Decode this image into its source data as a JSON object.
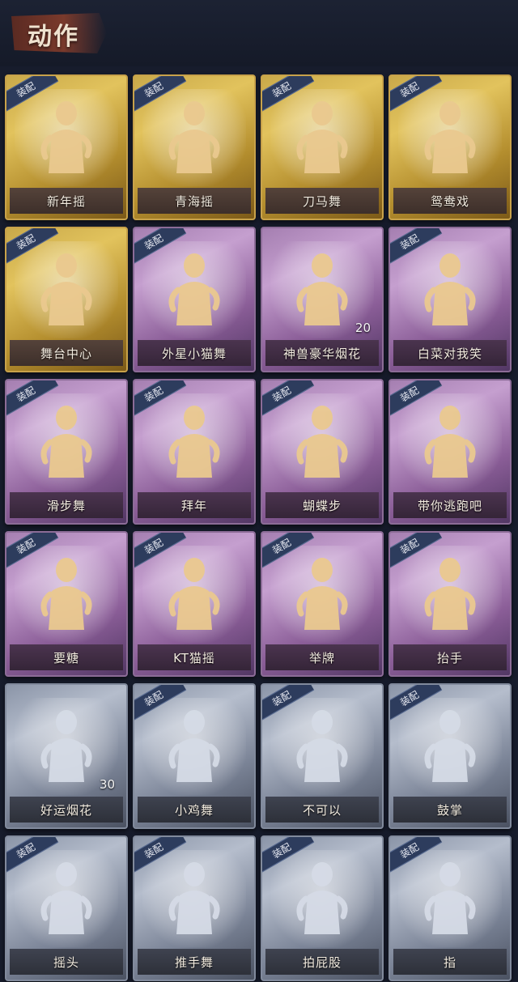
{
  "header": {
    "title": "动作"
  },
  "badge_label": "装配",
  "colors": {
    "gold": "#d8b451",
    "purple": "#b08bbd",
    "silver": "#a7afbf",
    "figure_gold": "#eac98f",
    "figure_silver": "#d5dbe6"
  },
  "actions": [
    {
      "label": "新年摇",
      "tier": "gold",
      "equipped": true,
      "count": ""
    },
    {
      "label": "青海摇",
      "tier": "gold",
      "equipped": true,
      "count": ""
    },
    {
      "label": "刀马舞",
      "tier": "gold",
      "equipped": true,
      "count": ""
    },
    {
      "label": "鸳鸯戏",
      "tier": "gold",
      "equipped": true,
      "count": ""
    },
    {
      "label": "舞台中心",
      "tier": "gold",
      "equipped": true,
      "count": ""
    },
    {
      "label": "外星小猫舞",
      "tier": "purple",
      "equipped": true,
      "count": ""
    },
    {
      "label": "神兽豪华烟花",
      "tier": "purple",
      "equipped": false,
      "count": "20"
    },
    {
      "label": "白菜对我笑",
      "tier": "purple",
      "equipped": true,
      "count": ""
    },
    {
      "label": "滑步舞",
      "tier": "purple",
      "equipped": true,
      "count": ""
    },
    {
      "label": "拜年",
      "tier": "purple",
      "equipped": true,
      "count": ""
    },
    {
      "label": "蝴蝶步",
      "tier": "purple",
      "equipped": true,
      "count": ""
    },
    {
      "label": "带你逃跑吧",
      "tier": "purple",
      "equipped": true,
      "count": ""
    },
    {
      "label": "要糖",
      "tier": "purple",
      "equipped": true,
      "count": ""
    },
    {
      "label": "KT猫摇",
      "tier": "purple",
      "equipped": true,
      "count": ""
    },
    {
      "label": "举牌",
      "tier": "purple",
      "equipped": true,
      "count": ""
    },
    {
      "label": "抬手",
      "tier": "purple",
      "equipped": true,
      "count": ""
    },
    {
      "label": "好运烟花",
      "tier": "silver",
      "equipped": false,
      "count": "30"
    },
    {
      "label": "小鸡舞",
      "tier": "silver",
      "equipped": true,
      "count": ""
    },
    {
      "label": "不可以",
      "tier": "silver",
      "equipped": true,
      "count": ""
    },
    {
      "label": "鼓掌",
      "tier": "silver",
      "equipped": true,
      "count": ""
    },
    {
      "label": "摇头",
      "tier": "silver",
      "equipped": true,
      "count": ""
    },
    {
      "label": "推手舞",
      "tier": "silver",
      "equipped": true,
      "count": ""
    },
    {
      "label": "拍屁股",
      "tier": "silver",
      "equipped": true,
      "count": ""
    },
    {
      "label": "指",
      "tier": "silver",
      "equipped": true,
      "count": ""
    }
  ]
}
